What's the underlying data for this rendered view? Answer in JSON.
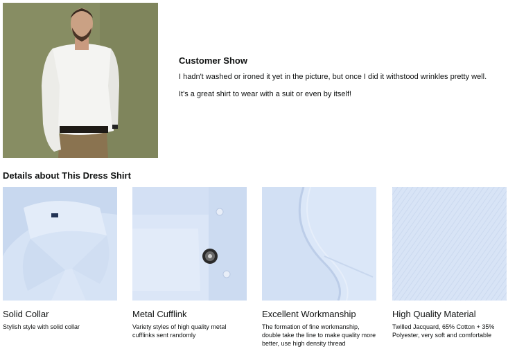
{
  "customer_show": {
    "title": "Customer Show",
    "paragraphs": [
      "I hadn't washed or ironed it yet in the picture, but once I did it withstood wrinkles pretty well.",
      "It's a great shirt to wear with a suit or even by itself!"
    ]
  },
  "details": {
    "title": "Details about This Dress Shirt",
    "items": [
      {
        "title": "Solid Collar",
        "desc": "Stylish style with solid collar"
      },
      {
        "title": "Metal Cufflink",
        "desc": "Variety styles of high quality metal cufflinks sent randomly"
      },
      {
        "title": "Excellent Workmanship",
        "desc": "The formation of fine workmanship, double take the line to make quality more better, use high density thread"
      },
      {
        "title": "High Quality Material",
        "desc": "Twilled Jacquard, 65% Cotton + 35% Polyester, very soft and comfortable"
      }
    ]
  }
}
